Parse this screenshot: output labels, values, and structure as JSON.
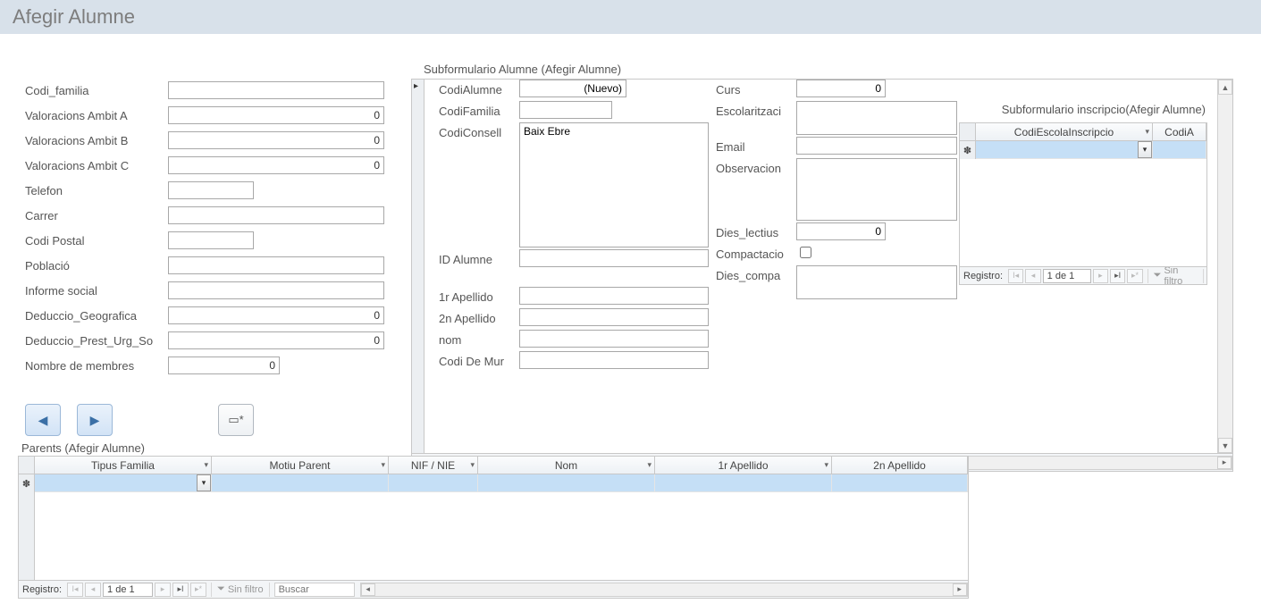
{
  "header": {
    "title": "Afegir Alumne"
  },
  "left": {
    "codi_familia": {
      "label": "Codi_familia",
      "value": ""
    },
    "val_a": {
      "label": "Valoracions Ambit A",
      "value": "0"
    },
    "val_b": {
      "label": "Valoracions Ambit B",
      "value": "0"
    },
    "val_c": {
      "label": "Valoracions Ambit C",
      "value": "0"
    },
    "telefon": {
      "label": "Telefon",
      "value": ""
    },
    "carrer": {
      "label": "Carrer",
      "value": ""
    },
    "codi_postal": {
      "label": "Codi Postal",
      "value": ""
    },
    "poblacio": {
      "label": "Població",
      "value": ""
    },
    "informe": {
      "label": "Informe social",
      "value": ""
    },
    "ded_geo": {
      "label": "Deduccio_Geografica",
      "value": "0"
    },
    "ded_prest": {
      "label": "Deduccio_Prest_Urg_So",
      "value": "0"
    },
    "membres": {
      "label": "Nombre  de membres",
      "value": "0"
    }
  },
  "subformA": {
    "title": "Subformulario Alumne (Afegir Alumne)",
    "codi_alumne": {
      "label": "CodiAlumne",
      "value": "(Nuevo)"
    },
    "codi_familia": {
      "label": "CodiFamilia",
      "value": ""
    },
    "codi_consell": {
      "label": "CodiConsell",
      "value": "Baix Ebre"
    },
    "id_alumne": {
      "label": "ID Alumne",
      "value": ""
    },
    "apellido1": {
      "label": "1r Apellido",
      "value": ""
    },
    "apellido2": {
      "label": "2n Apellido",
      "value": ""
    },
    "nom": {
      "label": "nom",
      "value": ""
    },
    "codi_mun": {
      "label": "Codi De Mur",
      "value": ""
    },
    "curs": {
      "label": "Curs",
      "value": "0"
    },
    "escolar": {
      "label": "Escolaritzaci",
      "value": ""
    },
    "email": {
      "label": "Email",
      "value": ""
    },
    "obs": {
      "label": "Observacion",
      "value": ""
    },
    "dies_lect": {
      "label": "Dies_lectius",
      "value": "0"
    },
    "compact": {
      "label": "Compactacio",
      "checked": false
    },
    "dies_compa": {
      "label": "Dies_compa",
      "value": ""
    }
  },
  "subformI": {
    "title": "Subformulario inscripcio(Afegir Alumne)",
    "columns": [
      "CodiEscolaInscripcio",
      "CodiA"
    ]
  },
  "parents": {
    "title": "Parents (Afegir Alumne)",
    "columns": [
      "Tipus Familia",
      "Motiu Parent",
      "NIF / NIE",
      "Nom",
      "1r Apellido",
      "2n Apellido"
    ]
  },
  "recnav": {
    "label": "Registro:",
    "pos": "1 de 1",
    "filter": "Sin filtro",
    "search_ph": "Buscar"
  },
  "icons": {
    "new_record": "✽"
  }
}
